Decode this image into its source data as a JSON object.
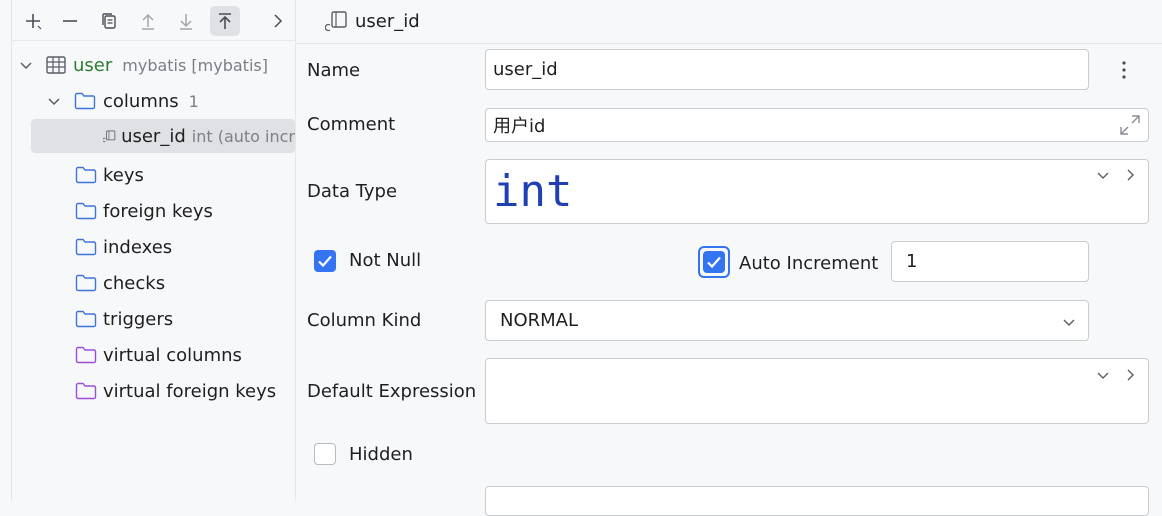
{
  "toolbar": {
    "icons": [
      "add-icon",
      "remove-icon",
      "duplicate-icon",
      "move-up-icon",
      "move-down-icon",
      "move-top-icon",
      "chevron-right-icon"
    ]
  },
  "tree": {
    "table": {
      "label": "user",
      "schema": "mybatis [mybatis]"
    },
    "columns": {
      "label": "columns",
      "count": "1"
    },
    "column_item": {
      "label": "user_id",
      "type": "int (auto incr"
    },
    "folders": [
      "keys",
      "foreign keys",
      "indexes",
      "checks",
      "triggers"
    ],
    "virtual": [
      "virtual columns",
      "virtual foreign keys"
    ]
  },
  "editor": {
    "title": "user_id",
    "name": {
      "label": "Name",
      "value": "user_id"
    },
    "comment": {
      "label": "Comment",
      "value": "用户id"
    },
    "data_type": {
      "label": "Data Type",
      "value": "int"
    },
    "not_null": {
      "label": "Not Null",
      "checked": true
    },
    "auto_increment": {
      "label": "Auto Increment",
      "checked": true,
      "value": "1"
    },
    "column_kind": {
      "label": "Column Kind",
      "value": "NORMAL"
    },
    "default_expression": {
      "label": "Default Expression",
      "value": ""
    },
    "hidden": {
      "label": "Hidden",
      "checked": false
    }
  },
  "colors": {
    "accent": "#3574f0",
    "table_name": "#2e7d32",
    "folder_blue": "#3d74d6",
    "folder_purple": "#9c4fd6",
    "type_blue": "#1f3fb3"
  }
}
